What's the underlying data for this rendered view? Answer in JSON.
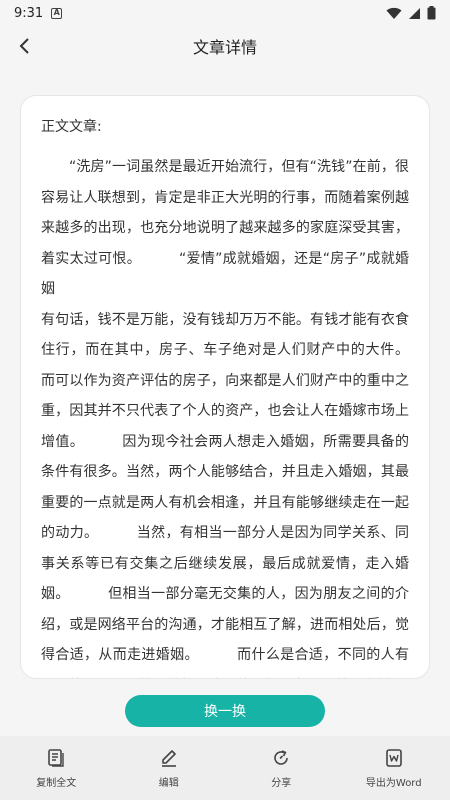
{
  "status_bar": {
    "time": "9:31",
    "notification_icon": "a-icon",
    "icons": [
      "wifi-icon",
      "signal-icon",
      "battery-icon"
    ]
  },
  "header": {
    "back_icon": "chevron-left-icon",
    "title": "文章详情"
  },
  "article": {
    "heading": "正文文章:",
    "body": "“洗房”一词虽然是最近开始流行，但有“洗钱”在前，很容易让人联想到，肯定是非正大光明的行事，而随着案例越来越多的出现，也充分地说明了越来越多的家庭深受其害，着实太过可恨。        “爱情”成就婚姻，还是“房子”成就婚姻\n有句话，钱不是万能，没有钱却万万不能。有钱才能有衣食住行，而在其中，房子、车子绝对是人们财产中的大件。        而可以作为资产评估的房子，向来都是人们财产中的重中之重，因其并不只代表了个人的资产，也会让人在婚嫁市场上增值。        因为现今社会两人想走入婚姻，所需要具备的条件有很多。当然，两个人能够结合，并且走入婚姻，其最重要的一点就是两人有机会相逢，并且有能够继续走在一起的动力。        当然，有相当一部分人是因为同学关系、同事关系等已有交集之后继续发展，最后成就爱情，走入婚姻。        但相当一部分毫无交集的人，因为朋友之间的介绍，或是网络平台的沟通，才能相互了解，进而相处后，觉得合适，从而走进婚姻。        而什么是合适，不同的人有不同的观点，可能是性格，也可能是物质条件，就像之前"
  },
  "switch_button": "换一换",
  "bottom_nav": [
    {
      "label": "复制全文",
      "icon": "document-copy-icon"
    },
    {
      "label": "编辑",
      "icon": "pencil-icon"
    },
    {
      "label": "分享",
      "icon": "share-refresh-icon"
    },
    {
      "label": "导出为Word",
      "icon": "word-export-icon"
    }
  ],
  "colors": {
    "accent": "#16b3a6",
    "background": "#f5f5f5",
    "card": "#ffffff",
    "bottom_bar": "#eeeeee"
  }
}
